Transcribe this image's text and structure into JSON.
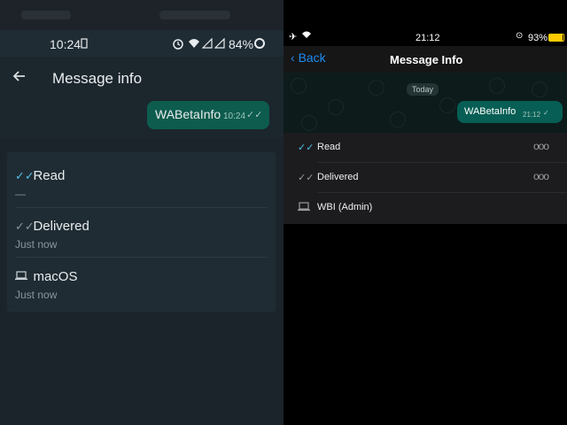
{
  "android": {
    "status_bar": {
      "time": "10:24",
      "battery_percent": "84%"
    },
    "header": {
      "title": "Message info"
    },
    "message": {
      "text": "WABetaInfo",
      "time": "10:24"
    },
    "info": [
      {
        "label": "Read",
        "subtext": "—"
      },
      {
        "label": "Delivered",
        "subtext": "Just now"
      },
      {
        "label": "macOS",
        "subtext": "Just now"
      }
    ]
  },
  "ios": {
    "status_bar": {
      "time": "21:12",
      "battery_percent": "93%"
    },
    "nav": {
      "back_label": "Back",
      "title": "Message Info"
    },
    "chat": {
      "date_label": "Today",
      "message_text": "WABetaInfo",
      "message_time": "21:12"
    },
    "info": [
      {
        "label": "Read",
        "more": "ooo"
      },
      {
        "label": "Delivered",
        "more": "ooo"
      },
      {
        "label": "WBI (Admin)"
      }
    ]
  },
  "colors": {
    "android_bg": "#1b232b",
    "android_card": "#202c33",
    "bubble_green": "#0d5c4d",
    "ios_bubble": "#075e54",
    "read_blue": "#53bdeb",
    "ios_accent": "#1d8bf1"
  }
}
